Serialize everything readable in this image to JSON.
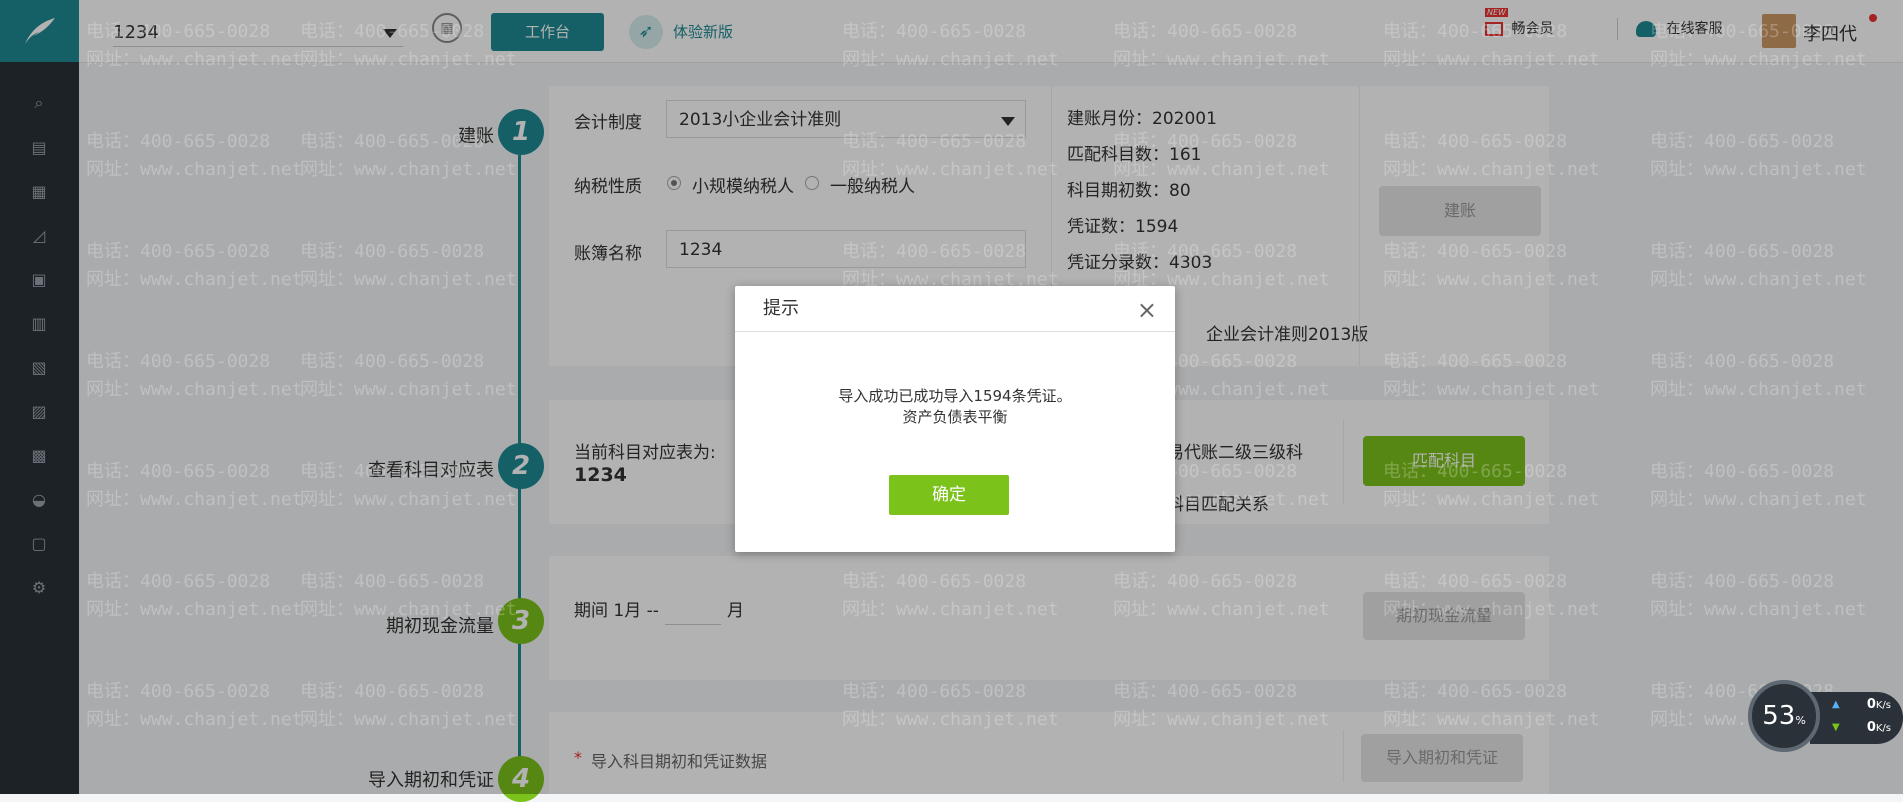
{
  "topbar": {
    "account_name": "1234",
    "workbench_label": "工作台",
    "new_version_label": "体验新版",
    "new_badge": "NEW",
    "vip_label": "畅会员",
    "service_label": "在线客服",
    "user_name": "李四代"
  },
  "steps": [
    {
      "num": "1",
      "label": "建账"
    },
    {
      "num": "2",
      "label": "查看科目对应表"
    },
    {
      "num": "3",
      "label": "期初现金流量"
    },
    {
      "num": "4",
      "label": "导入期初和凭证"
    }
  ],
  "step1": {
    "accounting_system_label": "会计制度",
    "accounting_system_value": "2013小企业会计准则",
    "taxpayer_label": "纳税性质",
    "taxpayer_small": "小规模纳税人",
    "taxpayer_general": "一般纳税人",
    "book_name_label": "账簿名称",
    "book_name_value": "1234",
    "info_month": "建账月份：202001",
    "info_matched": "匹配科目数：161",
    "info_opening": "科目期初数：80",
    "info_vouchers": "凭证数：1594",
    "info_entries": "凭证分录数：4303",
    "info_standard": "企业会计准则2013版",
    "create_button": "建账"
  },
  "step2": {
    "mapping_label": "当前科目对应表为:",
    "mapping_value": "1234",
    "note1": "易代账二级三级科",
    "note2": "科目匹配关系",
    "match_button": "匹配科目"
  },
  "step3": {
    "period_prefix": "期间 1月 --",
    "period_suffix": "月",
    "cashflow_button": "期初现金流量"
  },
  "step4": {
    "required_mark": "*",
    "hint": "导入科目期初和凭证数据",
    "import_button": "导入期初和凭证"
  },
  "dialog": {
    "title": "提示",
    "close": "×",
    "message_line1": "导入成功已成功导入1594条凭证。",
    "message_line2": "资产负债表平衡",
    "ok_button": "确定"
  },
  "watermark": {
    "phone": "电话：400-665-0028",
    "site": "网址：www.chanjet.net"
  },
  "speed_widget": {
    "percent": "53",
    "percent_unit": "%",
    "up_value": "0",
    "down_value": "0",
    "unit": "K/s"
  }
}
